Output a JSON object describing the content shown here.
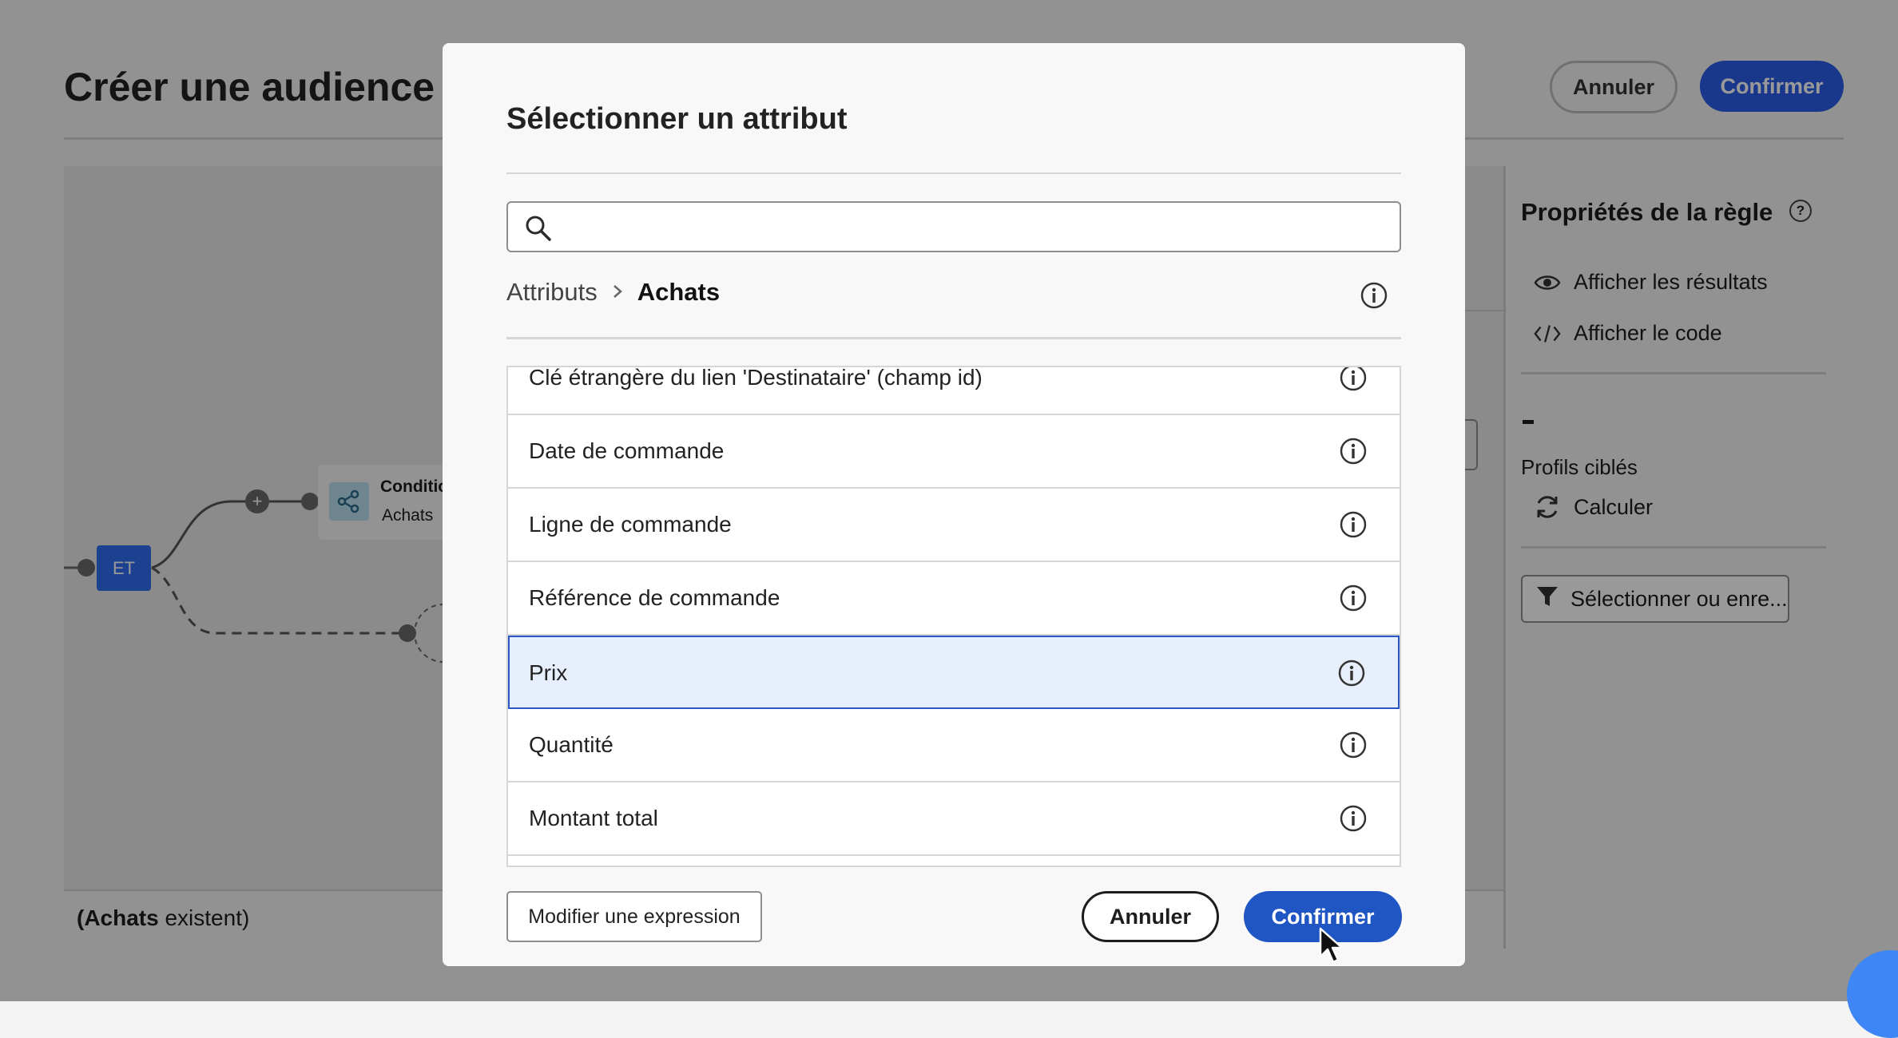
{
  "background": {
    "page_title": "Créer une audience",
    "header_buttons": {
      "cancel": "Annuler",
      "confirm": "Confirmer"
    },
    "canvas": {
      "and_node_label": "ET",
      "condition_node": {
        "title": "Conditio",
        "subtitle": "Achats"
      },
      "footer_expression_bold": "(Achats",
      "footer_expression_rest": " existent)"
    },
    "right_panel": {
      "title": "Propriétés de la règle",
      "show_results": "Afficher les résultats",
      "show_code": "Afficher le code",
      "dash": "-",
      "targeted_profiles": "Profils ciblés",
      "calculate": "Calculer",
      "select_or_save": "Sélectionner ou enre..."
    }
  },
  "dialog": {
    "title": "Sélectionner un attribut",
    "search": {
      "value": "",
      "placeholder": ""
    },
    "breadcrumb": {
      "root": "Attributs",
      "current": "Achats"
    },
    "attributes": [
      {
        "label": "Clé étrangère du lien 'Destinataire' (champ id)",
        "selected": false
      },
      {
        "label": "Date de commande",
        "selected": false
      },
      {
        "label": "Ligne de commande",
        "selected": false
      },
      {
        "label": "Référence de commande",
        "selected": false
      },
      {
        "label": "Prix",
        "selected": true
      },
      {
        "label": "Quantité",
        "selected": false
      },
      {
        "label": "Montant total",
        "selected": false
      }
    ],
    "buttons": {
      "edit_expression": "Modifier une expression",
      "cancel": "Annuler",
      "confirm": "Confirmer"
    }
  },
  "colors": {
    "accent": "#2055c4",
    "selected_row_bg": "#e8effc",
    "overlay": "rgba(0,0,0,0.4)"
  },
  "icons": [
    "search-icon",
    "info-icon",
    "eye-icon",
    "code-icon",
    "refresh-icon",
    "filter-icon",
    "help-icon",
    "share-icon",
    "pointer-cursor-icon"
  ]
}
